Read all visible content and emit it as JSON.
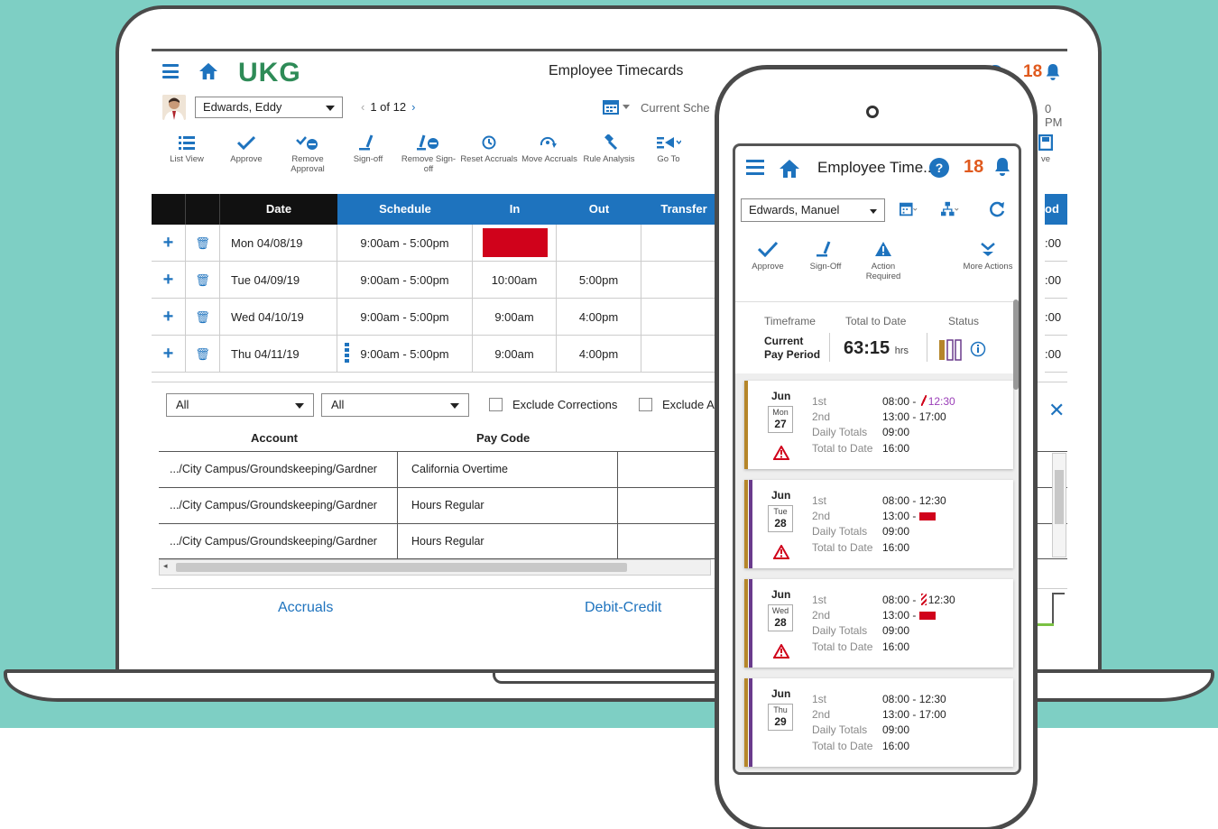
{
  "header": {
    "logo": "UKG",
    "title": "Employee Timecards",
    "help": "?",
    "notification_count": "18"
  },
  "employee": {
    "name": "Edwards, Eddy",
    "pager": "1 of 12",
    "schedule_period": "Current Sche",
    "time_fragment": "0 PM"
  },
  "toolbar": [
    {
      "label": "List View",
      "icon": "list-icon"
    },
    {
      "label": "Approve",
      "icon": "check-icon"
    },
    {
      "label": "Remove Approval",
      "icon": "remove-approval-icon"
    },
    {
      "label": "Sign-off",
      "icon": "signoff-icon"
    },
    {
      "label": "Remove Sign-off",
      "icon": "remove-signoff-icon"
    },
    {
      "label": "Reset Accruals",
      "icon": "reset-icon"
    },
    {
      "label": "Move Accruals",
      "icon": "move-icon"
    },
    {
      "label": "Rule Analysis",
      "icon": "gavel-icon"
    },
    {
      "label": "Go To",
      "icon": "goto-icon"
    }
  ],
  "toolbar_right_fragment": "ve",
  "grid": {
    "headers": [
      "Date",
      "Schedule",
      "In",
      "Out",
      "Transfer"
    ],
    "right_header_fragment": "od",
    "rows": [
      {
        "date": "Mon 04/08/19",
        "schedule": "9:00am - 5:00pm",
        "in": "",
        "out": "",
        "right": ":00"
      },
      {
        "date": "Tue 04/09/19",
        "schedule": "9:00am - 5:00pm",
        "in": "10:00am",
        "out": "5:00pm",
        "right": ":00"
      },
      {
        "date": "Wed 04/10/19",
        "schedule": "9:00am - 5:00pm",
        "in": "9:00am",
        "out": "4:00pm",
        "right": ":00"
      },
      {
        "date": "Thu 04/11/19",
        "schedule": "9:00am - 5:00pm",
        "in": "9:00am",
        "out": "4:00pm",
        "right": ":00"
      }
    ]
  },
  "filters": {
    "filter1": "All",
    "filter2": "All",
    "exclude_corrections": "Exclude Corrections",
    "exclude_other": "Exclude A"
  },
  "accounts": {
    "headers": [
      "Account",
      "Pay Code"
    ],
    "rows": [
      {
        "account": ".../City Campus/Groundskeeping/Gardner",
        "pay_code": "California Overtime"
      },
      {
        "account": ".../City Campus/Groundskeeping/Gardner",
        "pay_code": "Hours Regular"
      },
      {
        "account": ".../City Campus/Groundskeeping/Gardner",
        "pay_code": "Hours Regular"
      }
    ]
  },
  "tabs": [
    "Accruals",
    "Debit-Credit"
  ],
  "phone": {
    "title": "Employee Time...",
    "help": "?",
    "notification_count": "18",
    "employee": "Edwards, Manuel",
    "tools": [
      "Approve",
      "Sign-Off",
      "Action Required",
      "More Actions"
    ],
    "summary": {
      "timeframe_label": "Timeframe",
      "total_label": "Total to Date",
      "status_label": "Status",
      "period_line1": "Current",
      "period_line2": "Pay Period",
      "total": "63:15",
      "unit": "hrs"
    },
    "cards": [
      {
        "month": "Jun",
        "dow": "Mon",
        "day": "27",
        "first": "08:00 - ",
        "first_end": "12:30",
        "second": "13:00 - 17:00",
        "daily": "09:00",
        "to_date": "16:00",
        "colors": [
          "#b5862a",
          "#b5862a"
        ]
      },
      {
        "month": "Jun",
        "dow": "Tue",
        "day": "28",
        "first": "08:00 - 12:30",
        "first_end": "",
        "second": "13:00 - ",
        "daily": "09:00",
        "to_date": "16:00",
        "colors": [
          "#b5862a",
          "#6a3b8c"
        ]
      },
      {
        "month": "Jun",
        "dow": "Wed",
        "day": "28",
        "first": "08:00 - ",
        "first_end": "12:30",
        "second": "13:00 - ",
        "daily": "09:00",
        "to_date": "16:00",
        "colors": [
          "#b5862a",
          "#6a3b8c"
        ]
      },
      {
        "month": "Jun",
        "dow": "Thu",
        "day": "29",
        "first": "08:00 - 12:30",
        "first_end": "",
        "second": "13:00 - 17:00",
        "daily": "09:00",
        "to_date": "16:00",
        "colors": [
          "#b5862a",
          "#6a3b8c"
        ]
      }
    ],
    "row_labels": [
      "1st",
      "2nd",
      "Daily Totals",
      "Total to Date"
    ]
  },
  "colors": {
    "accent": "#1e73be",
    "brand": "#2e8b57",
    "alert": "#e05a1e",
    "missed": "#d0021b",
    "teal_bg": "#7ecfc4"
  }
}
